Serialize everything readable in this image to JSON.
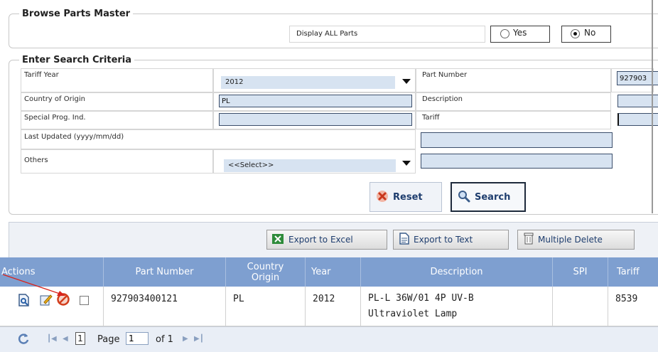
{
  "browse": {
    "legend": "Browse Parts Master",
    "display_all_label": "Display ALL Parts",
    "yes_label": "Yes",
    "no_label": "No",
    "selected": "No"
  },
  "criteria": {
    "legend": "Enter Search Criteria",
    "tariff_year_label": "Tariff Year",
    "tariff_year_value": "2012",
    "part_number_label": "Part Number",
    "part_number_value": "927903",
    "country_label": "Country of Origin",
    "country_value": "PL",
    "description_label": "Description",
    "description_value": "",
    "spi_label": "Special Prog. Ind.",
    "spi_value": "",
    "tariff_label": "Tariff",
    "tariff_value": "",
    "last_updated_label": "Last Updated (yyyy/mm/dd)",
    "last_updated_value": "",
    "others_label": "Others",
    "others_value": "<<Select>>",
    "others_text": ""
  },
  "buttons": {
    "reset": "Reset",
    "search": "Search",
    "export_excel": "Export to Excel",
    "export_text": "Export to Text",
    "multiple_delete": "Multiple Delete"
  },
  "grid": {
    "headers": {
      "actions": "Actions",
      "part_number": "Part Number",
      "country_origin_1": "Country",
      "country_origin_2": "Origin",
      "year": "Year",
      "description": "Description",
      "spi": "SPI",
      "tariff": "Tariff"
    },
    "rows": [
      {
        "part_number": "927903400121",
        "country": "PL",
        "year": "2012",
        "description_1": "PL-L 36W/01 4P UV-B",
        "description_2": "Ultraviolet Lamp",
        "spi": "",
        "tariff": "8539"
      }
    ]
  },
  "pager": {
    "current_page_box": "1",
    "page_label": "Page",
    "page_input": "1",
    "of_label": "of 1"
  },
  "colors": {
    "header_bg": "#7e9fd0",
    "input_bg": "#d7e3f1",
    "annotation_arrow": "#d9241c"
  }
}
